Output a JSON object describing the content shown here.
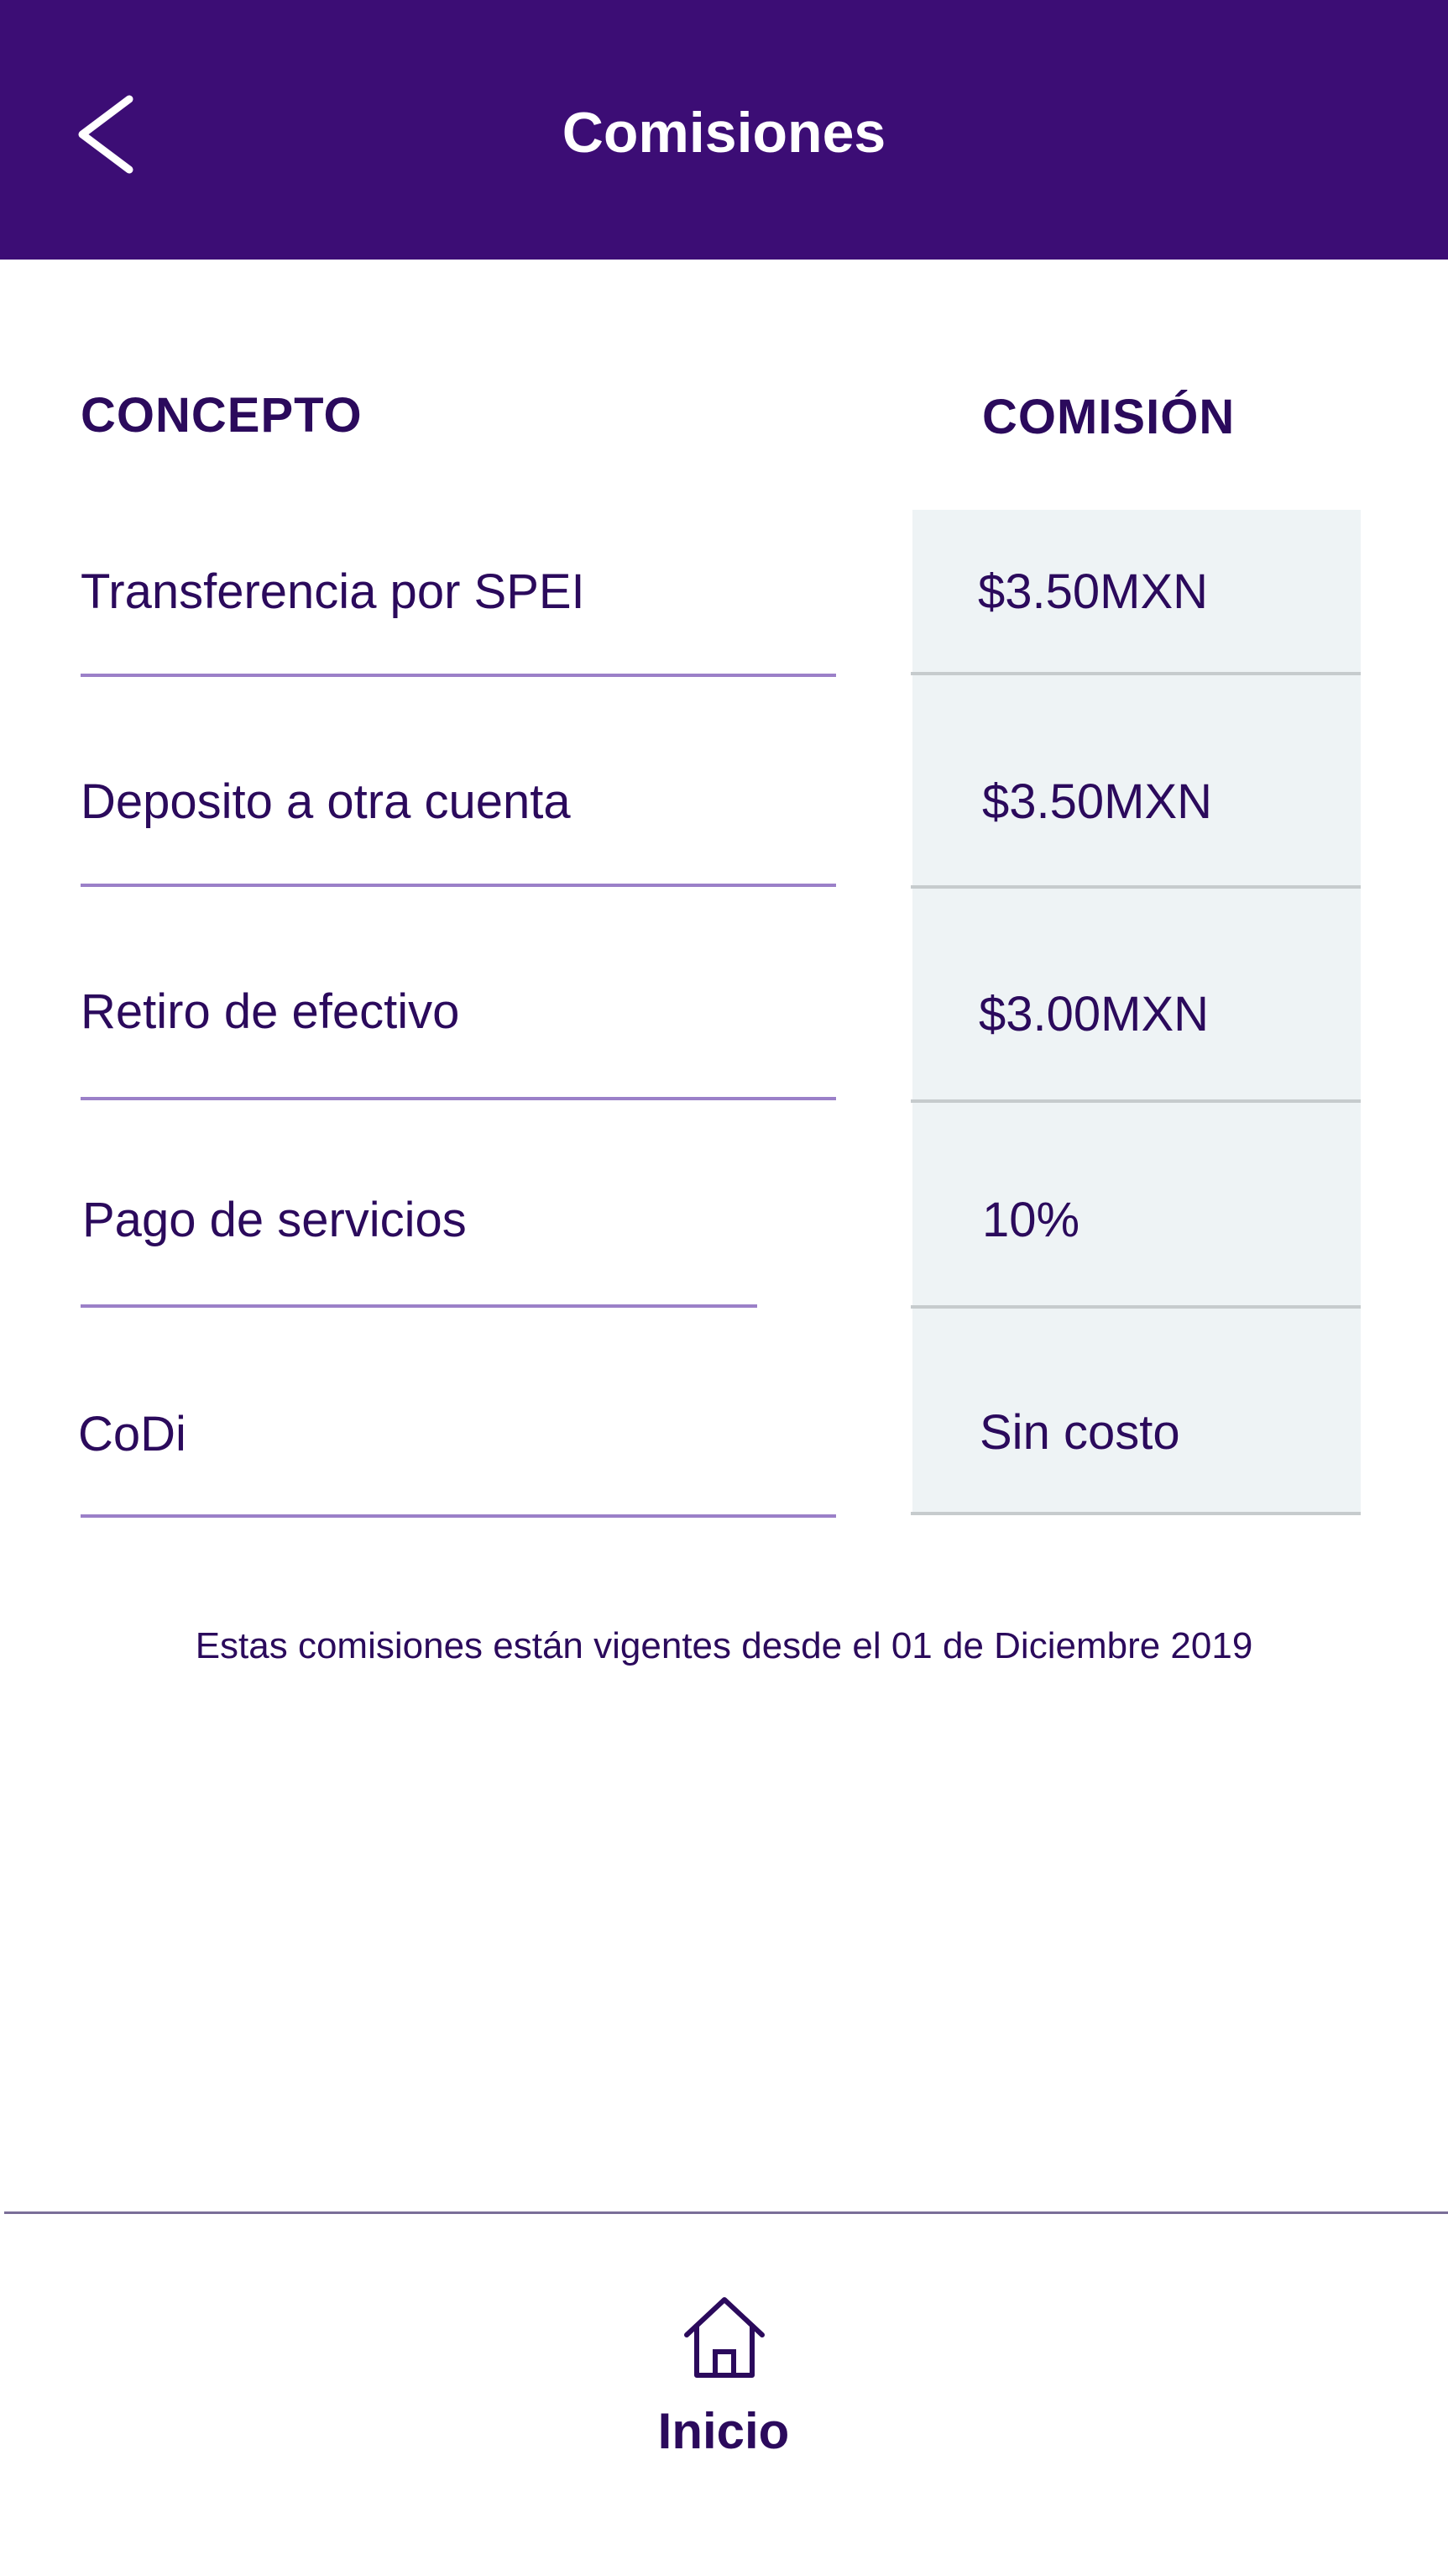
{
  "header": {
    "title": "Comisiones",
    "back_icon": "chevron-left-icon"
  },
  "table": {
    "col_concept": "CONCEPTO",
    "col_fee": "COMISIÓN",
    "rows": [
      {
        "concept": "Transferencia por SPEI",
        "fee": "$3.50MXN"
      },
      {
        "concept": "Deposito a otra cuenta",
        "fee": "$3.50MXN"
      },
      {
        "concept": "Retiro de efectivo",
        "fee": "$3.00MXN"
      },
      {
        "concept": "Pago de servicios",
        "fee": "10%"
      },
      {
        "concept": "CoDi",
        "fee": "Sin costo"
      }
    ]
  },
  "footnote": "Estas comisiones están vigentes desde el 01 de Diciembre 2019",
  "tabbar": {
    "home_label": "Inicio",
    "home_icon": "home-icon"
  },
  "colors": {
    "header_bg": "#3c0d75",
    "text": "#2b0a5c",
    "fee_panel_bg": "#eef3f5",
    "concept_underline": "#9b80c8"
  }
}
